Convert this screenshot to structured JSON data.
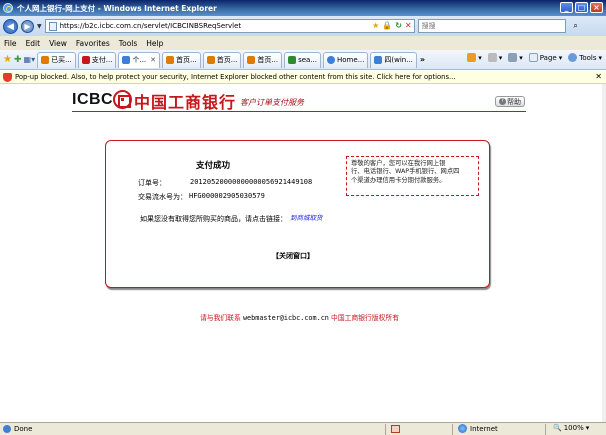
{
  "window": {
    "title": "个人网上银行-网上支付 - Windows Internet Explorer",
    "minimize": "_",
    "maximize": "□",
    "close": "×"
  },
  "address": {
    "url": "https://b2c.icbc.com.cn/servlet/ICBCINBSReqServlet",
    "search_placeholder": "搜搜"
  },
  "menu": [
    "File",
    "Edit",
    "View",
    "Favorites",
    "Tools",
    "Help"
  ],
  "tabs": [
    {
      "label": "已买...",
      "color": "#e07b00"
    },
    {
      "label": "支付...",
      "color": "#c8161d"
    },
    {
      "label": "个...",
      "color": "#3d7fd6",
      "active": true
    },
    {
      "label": "首页...",
      "color": "#e07b00"
    },
    {
      "label": "首页...",
      "color": "#e07b00"
    },
    {
      "label": "首页...",
      "color": "#e07b00"
    },
    {
      "label": "sea...",
      "color": "#2f8b2f"
    },
    {
      "label": "Home...",
      "color": "#3d7fd6"
    },
    {
      "label": "四(win...",
      "color": "#3d7fd6"
    }
  ],
  "tab_more": "»",
  "tools_right": {
    "page": "Page",
    "tools": "Tools"
  },
  "infobar": {
    "text": "Pop-up blocked. Also, to help protect your security, Internet Explorer blocked other content from this site. Click here for options..."
  },
  "page": {
    "icbc": "ICBC",
    "bank_name": "中国工商银行",
    "service_title": "客户订单支付服务",
    "help": "帮助",
    "success_title": "支付成功",
    "order_label": "订单号：",
    "order_value": "20120520000000000056921449108",
    "serial_label": "交易流水号为：",
    "serial_value": "HFG000002905030579",
    "back_text": "如果您没有取得您所购买的商品，请点击链接：",
    "back_link": "到商城取货",
    "close_window": "【关闭窗口】",
    "notice_lines": [
      "尊敬的客户，您可以在我行网上银",
      "行、电话银行、WAP手机银行、网点四",
      "个渠道办理信用卡分期付款服务。"
    ],
    "footer_prefix": "请与我们联系 ",
    "footer_email": "webmaster@icbc.com.cn",
    "footer_suffix": " 中国工商银行版权所有"
  },
  "status": {
    "done": "Done",
    "zone": "Internet",
    "zoom": "100%"
  }
}
